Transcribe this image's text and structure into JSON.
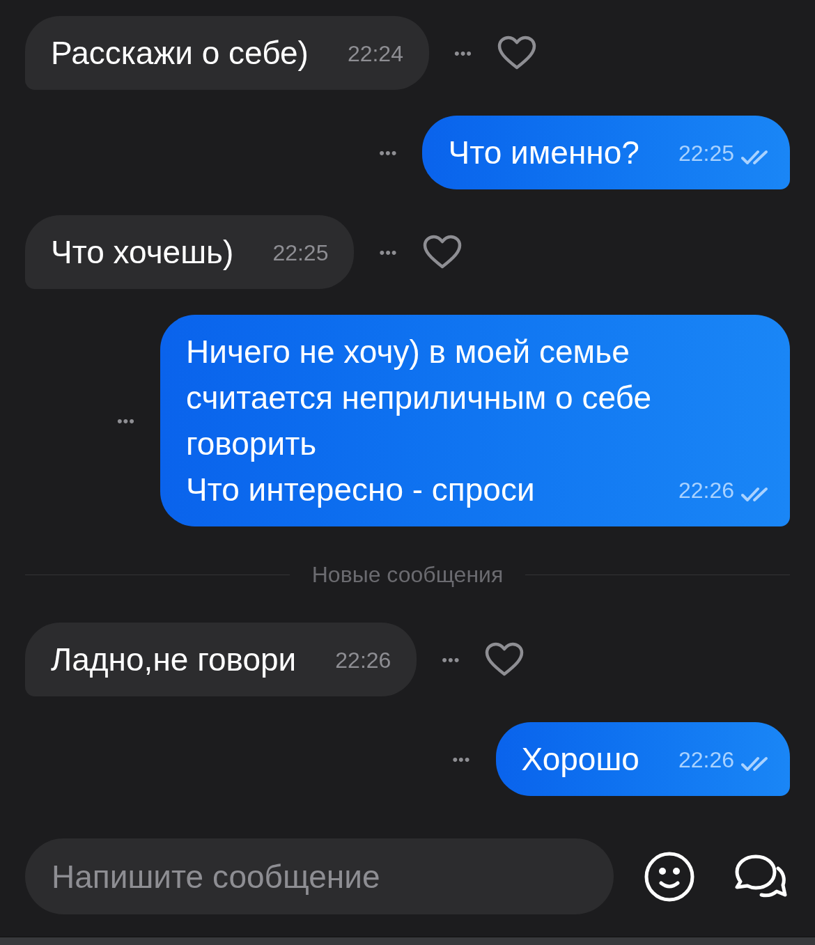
{
  "messages": [
    {
      "kind": "incoming",
      "text": "Расскажи о себе)",
      "time": "22:24",
      "more": "•••"
    },
    {
      "kind": "outgoing",
      "text": "Что именно?",
      "time": "22:25",
      "read": true,
      "more": "•••"
    },
    {
      "kind": "incoming",
      "text": "Что хочешь)",
      "time": "22:25",
      "more": "•••"
    },
    {
      "kind": "outgoing",
      "text": "Ничего не хочу) в моей семье считается неприличным о себе говорить\nЧто интересно - спроси",
      "time": "22:26",
      "read": true,
      "more": "•••"
    },
    {
      "kind": "divider",
      "text": "Новые сообщения"
    },
    {
      "kind": "incoming",
      "text": "Ладно,не говори",
      "time": "22:26",
      "more": "•••"
    },
    {
      "kind": "outgoing",
      "text": "Хорошо",
      "time": "22:26",
      "read": true,
      "more": "•••"
    }
  ],
  "composer": {
    "placeholder": "Напишите сообщение"
  }
}
